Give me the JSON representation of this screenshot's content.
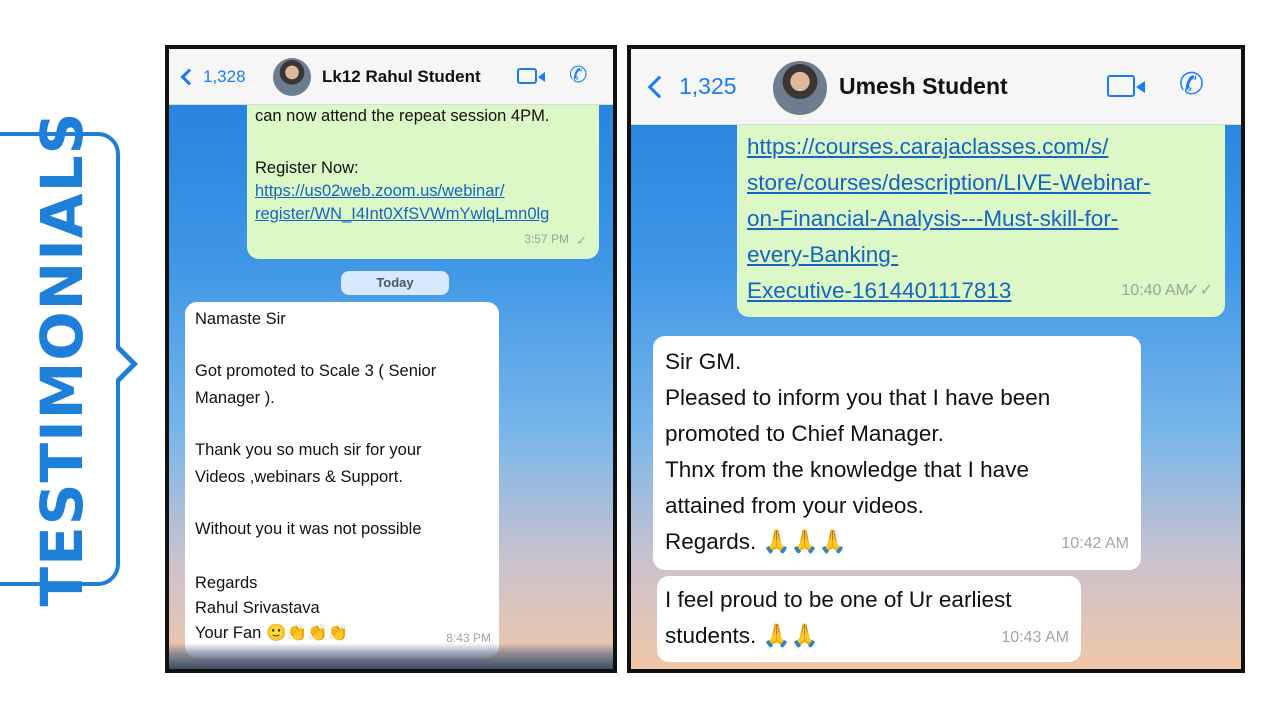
{
  "side_label": "TESTIMONIALS",
  "colors": {
    "accent": "#1e7fd8",
    "link": "#1565c0",
    "outgoing_bubble": "#dcf8c6",
    "ios_blue": "#1a7cf4"
  },
  "left_chat": {
    "back_count": "1,328",
    "contact_name": "Lk12 Rahul Student",
    "icons": [
      "video-camera-icon",
      "phone-icon"
    ],
    "outgoing": {
      "lines": [
        "can now attend the repeat session 4PM.",
        "",
        "Register Now:"
      ],
      "link_lines": [
        "https://us02web.zoom.us/webinar/",
        "register/WN_I4Int0XfSVWmYwlqLmn0lg"
      ],
      "time": "3:57 PM"
    },
    "date_separator": "Today",
    "incoming": {
      "lines": [
        "Namaste Sir",
        "",
        "Got promoted to Scale 3 ( Senior",
        "Manager ).",
        "",
        "Thank you so much sir for your",
        "Videos ,webinars & Support.",
        "",
        "Without you it was not possible",
        "",
        "Regards",
        "Rahul Srivastava",
        "Your Fan 🙂👏👏👏"
      ],
      "time": "8:43 PM"
    }
  },
  "right_chat": {
    "back_count": "1,325",
    "contact_name": "Umesh Student",
    "icons": [
      "video-camera-icon",
      "phone-icon"
    ],
    "outgoing": {
      "link_lines": [
        "https://courses.carajaclasses.com/s/",
        "store/courses/description/LIVE-Webinar-",
        "on-Financial-Analysis---Must-skill-for-",
        "every-Banking-",
        "Executive-1614401117813"
      ],
      "time": "10:40 AM"
    },
    "incoming": [
      {
        "lines": [
          "Sir GM.",
          "Pleased to inform you that I have been",
          "promoted to Chief  Manager.",
          "Thnx from the knowledge that I have",
          "attained from your videos.",
          "Regards. 🙏🙏🙏"
        ],
        "time": "10:42 AM"
      },
      {
        "lines": [
          "I feel proud to be one of Ur earliest",
          "students. 🙏🙏"
        ],
        "time": "10:43 AM"
      }
    ]
  }
}
